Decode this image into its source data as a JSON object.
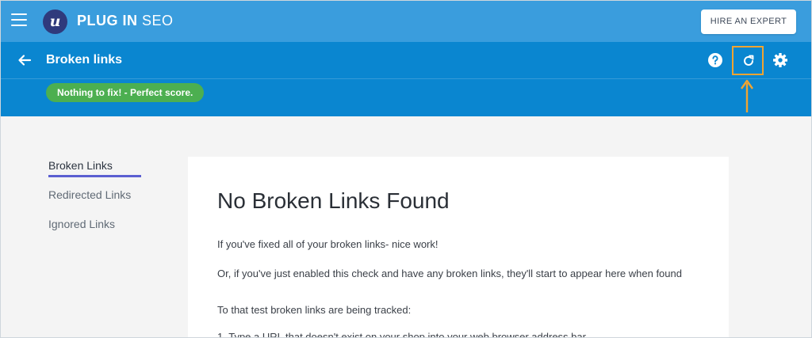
{
  "app": {
    "brand_bold": "PLUG IN",
    "brand_light": "SEO",
    "logo_letter": "u",
    "hire_button": "HIRE AN EXPERT"
  },
  "header": {
    "title": "Broken links",
    "score_badge": "Nothing to fix! - Perfect score."
  },
  "sidebar": {
    "items": [
      {
        "label": "Broken Links",
        "active": true
      },
      {
        "label": "Redirected Links",
        "active": false
      },
      {
        "label": "Ignored Links",
        "active": false
      }
    ]
  },
  "content": {
    "heading": "No Broken Links Found",
    "paragraphs": [
      "If you've fixed all of your broken links- nice work!",
      "Or, if you've just enabled this check and have any broken links, they'll start to appear here when found",
      "To that test broken links are being tracked:",
      "1. Type a URL that doesn't exist on your shop into your web browser address bar"
    ]
  },
  "icons": {
    "menu": "hamburger-icon",
    "back": "arrow-left-icon",
    "help": "question-circle-icon",
    "refresh": "refresh-icon",
    "settings": "gear-icon",
    "callout": "arrow-up-icon"
  },
  "colors": {
    "topbar": "#3a9ddd",
    "subbar": "#0a86d0",
    "badge": "#4caf50",
    "highlight": "#f0a431",
    "nav_active_underline": "#5b5fd1",
    "logo": "#2f3a7c"
  }
}
